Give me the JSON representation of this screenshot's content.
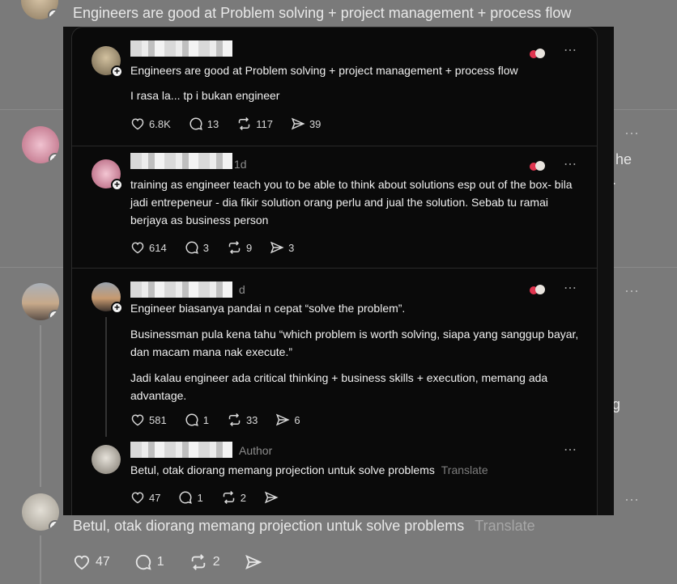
{
  "background": {
    "top_post_text": "Engineers are good at Problem solving + project management + process flow",
    "peek_he": "he",
    "peek_dot": ".",
    "peek_g": "g",
    "bottom_reply_text": "Betul, otak diorang memang projection untuk solve problems",
    "bottom_reply_translate": "Translate",
    "bottom_actions": {
      "likes": "47",
      "replies": "1",
      "reposts": "2"
    },
    "more_icon": "⋯"
  },
  "thread": {
    "posts": [
      {
        "text": "Engineers are good at Problem solving + project management + process flow",
        "text2": "I rasa la... tp i bukan engineer",
        "likes": "6.8K",
        "replies": "13",
        "reposts": "117",
        "shares": "39"
      },
      {
        "time": "1d",
        "text": "training as engineer teach you to be able to think about solutions esp out of the box- bila jadi entrepeneur - dia fikir solution orang perlu and jual the solution. Sebab tu ramai berjaya as business person",
        "likes": "614",
        "replies": "3",
        "reposts": "9",
        "shares": "3"
      },
      {
        "time": "d",
        "p1": "Engineer biasanya pandai n cepat “solve the problem”.",
        "p2": "Businessman pula kena tahu “which problem is worth solving, siapa yang sanggup bayar, dan macam mana nak execute.”",
        "p3": "Jadi kalau engineer ada critical thinking + business skills + execution, memang ada advantage.",
        "likes": "581",
        "replies": "1",
        "reposts": "33",
        "shares": "6"
      },
      {
        "tag": "Author",
        "text": "Betul, otak diorang memang projection untuk solve problems",
        "translate": "Translate",
        "likes": "47",
        "replies": "1",
        "reposts": "2"
      }
    ],
    "more_icon": "⋯"
  }
}
